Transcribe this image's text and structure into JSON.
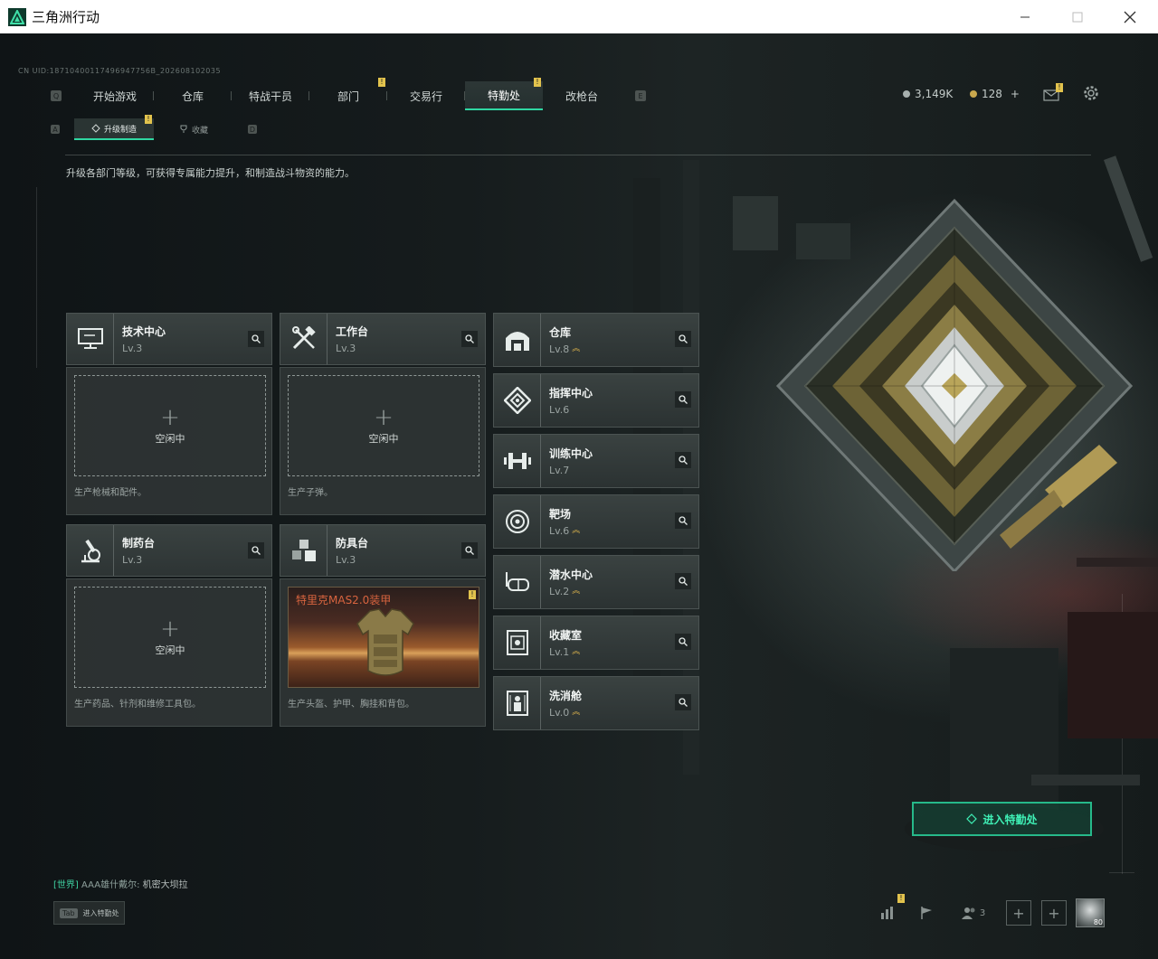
{
  "window": {
    "title": "三角洲行动"
  },
  "uid": "CN UID:18710400117496947756B_202608102035",
  "nav": {
    "left_key": "Q",
    "right_key": "E",
    "tabs": [
      {
        "label": "开始游戏",
        "active": false,
        "badge": ""
      },
      {
        "label": "仓库",
        "active": false,
        "badge": ""
      },
      {
        "label": "特战干员",
        "active": false,
        "badge": ""
      },
      {
        "label": "部门",
        "active": false,
        "badge": "!"
      },
      {
        "label": "交易行",
        "active": false,
        "badge": ""
      },
      {
        "label": "特勤处",
        "active": true,
        "badge": "!"
      },
      {
        "label": "改枪台",
        "active": false,
        "badge": ""
      }
    ]
  },
  "subnav": {
    "left_key": "A",
    "right_key": "D",
    "tabs": [
      {
        "label": "升级制造",
        "active": true,
        "badge": "!"
      },
      {
        "label": "收藏",
        "active": false,
        "badge": ""
      }
    ]
  },
  "currency": {
    "coins": "3,149K",
    "tickets": "128"
  },
  "mail_badge": "!",
  "description": "升级各部门等级，可获得专属能力提升，和制造战斗物资的能力。",
  "stations": [
    {
      "name": "技术中心",
      "level": "Lv.3",
      "status": "空闲中",
      "caption": "生产枪械和配件。"
    },
    {
      "name": "工作台",
      "level": "Lv.3",
      "status": "空闲中",
      "caption": "生产子弹。"
    },
    {
      "name": "制药台",
      "level": "Lv.3",
      "status": "空闲中",
      "caption": "生产药品、针剂和维修工具包。"
    },
    {
      "name": "防具台",
      "level": "Lv.3",
      "item": "特里克MAS2.0装甲",
      "item_badge": "!",
      "caption": "生产头盔、护甲、胸挂和背包。"
    }
  ],
  "departments": [
    {
      "name": "仓库",
      "level": "Lv.8",
      "upgrade": true
    },
    {
      "name": "指挥中心",
      "level": "Lv.6",
      "upgrade": false
    },
    {
      "name": "训练中心",
      "level": "Lv.7",
      "upgrade": false
    },
    {
      "name": "靶场",
      "level": "Lv.6",
      "upgrade": true
    },
    {
      "name": "潜水中心",
      "level": "Lv.2",
      "upgrade": true
    },
    {
      "name": "收藏室",
      "level": "Lv.1",
      "upgrade": true
    },
    {
      "name": "洗消舱",
      "level": "Lv.0",
      "upgrade": true
    }
  ],
  "enter_button": "进入特勤处",
  "chat": {
    "channel": "[世界]",
    "sender": "AAA雄什戴尔:",
    "message": "机密大坝拉"
  },
  "tab_hint": {
    "key": "Tab",
    "label": "进入特勤处"
  },
  "bottom": {
    "stats_badge": "!",
    "team_count": "3",
    "avatar_level": "80"
  },
  "colors": {
    "accent": "#2fd7a2",
    "badge": "#e2c34d",
    "upgrade_arrow": "#e2b84d",
    "armor_name": "#d8643f"
  }
}
